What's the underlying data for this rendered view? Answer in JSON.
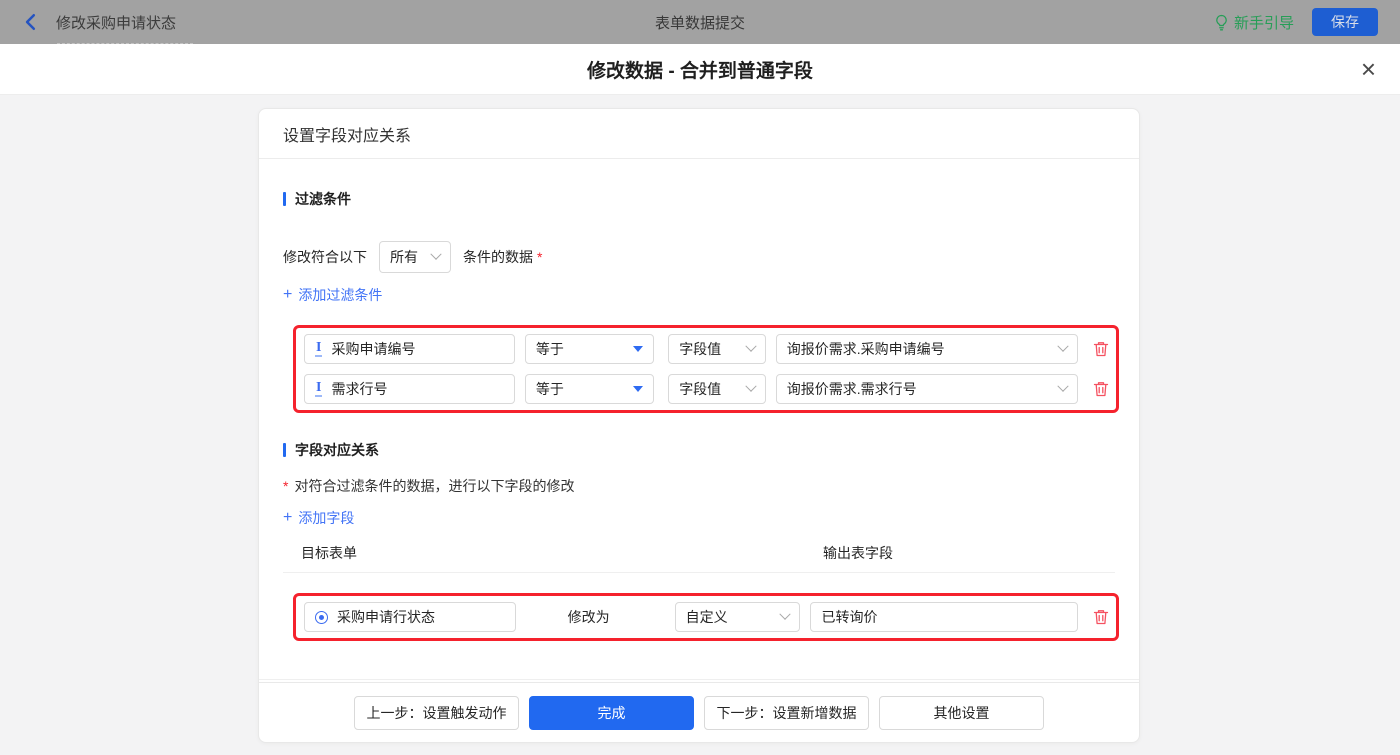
{
  "topbar": {
    "back_title": "修改采购申请状态",
    "center_title": "表单数据提交",
    "guide_label": "新手引导",
    "save_label": "保存"
  },
  "dialog": {
    "title": "修改数据 - 合并到普通字段",
    "close_glyph": "×"
  },
  "panel": {
    "header": "设置字段对应关系",
    "filter": {
      "title": "过滤条件",
      "match_prefix": "修改符合以下",
      "match_mode": "所有",
      "match_suffix": "条件的数据",
      "required_mark": "*",
      "add_icon": "+",
      "add_label": "添加过滤条件",
      "rows": [
        {
          "field": "采购申请编号",
          "operator": "等于",
          "value_type": "字段值",
          "value": "询报价需求.采购申请编号"
        },
        {
          "field": "需求行号",
          "operator": "等于",
          "value_type": "字段值",
          "value": "询报价需求.需求行号"
        }
      ]
    },
    "mapping": {
      "title": "字段对应关系",
      "required_mark": "*",
      "note": "对符合过滤条件的数据，进行以下字段的修改",
      "add_icon": "+",
      "add_label": "添加字段",
      "col_target": "目标表单",
      "col_output": "输出表字段",
      "rows": [
        {
          "field": "采购申请行状态",
          "action": "修改为",
          "value_type": "自定义",
          "value": "已转询价"
        }
      ]
    },
    "footer": {
      "prev_label": "上一步：设置触发动作",
      "done_label": "完成",
      "next_label": "下一步：设置新增数据",
      "other_label": "其他设置"
    }
  },
  "icons": {
    "text_field": "I"
  },
  "colors": {
    "primary_blue": "#2169f0",
    "highlight_red": "#f5222d",
    "link_blue": "#4374f6",
    "guide_green": "#279e57",
    "trash_red": "#f55160",
    "section_bar_blue": "#2169f0"
  }
}
